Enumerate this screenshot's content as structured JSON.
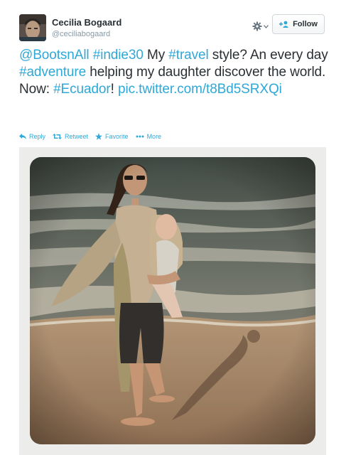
{
  "user": {
    "name": "Cecilia Bogaard",
    "handle": "@ceciliabogaard"
  },
  "follow_button": {
    "label": "Follow"
  },
  "tweet": {
    "segments": [
      {
        "text": "@BootsnAll",
        "link": true
      },
      {
        "text": " ",
        "link": false
      },
      {
        "text": "#indie30",
        "link": true
      },
      {
        "text": " My ",
        "link": false
      },
      {
        "text": "#travel",
        "link": true
      },
      {
        "text": " style? An every day ",
        "link": false
      },
      {
        "text": "#adventure",
        "link": true
      },
      {
        "text": " helping my daughter discover the world. Now: ",
        "link": false
      },
      {
        "text": "#Ecuador",
        "link": true
      },
      {
        "text": "! ",
        "link": false
      },
      {
        "text": "pic.twitter.com/t8Bd5SRXQi",
        "link": true
      }
    ]
  },
  "actions": [
    {
      "label": "Reply",
      "icon": "reply-icon"
    },
    {
      "label": "Retweet",
      "icon": "retweet-icon"
    },
    {
      "label": "Favorite",
      "icon": "star-icon"
    },
    {
      "label": "More",
      "icon": "more-icon"
    }
  ],
  "colors": {
    "link": "#2fa8d8",
    "text": "#292f33",
    "muted": "#8899a6"
  }
}
